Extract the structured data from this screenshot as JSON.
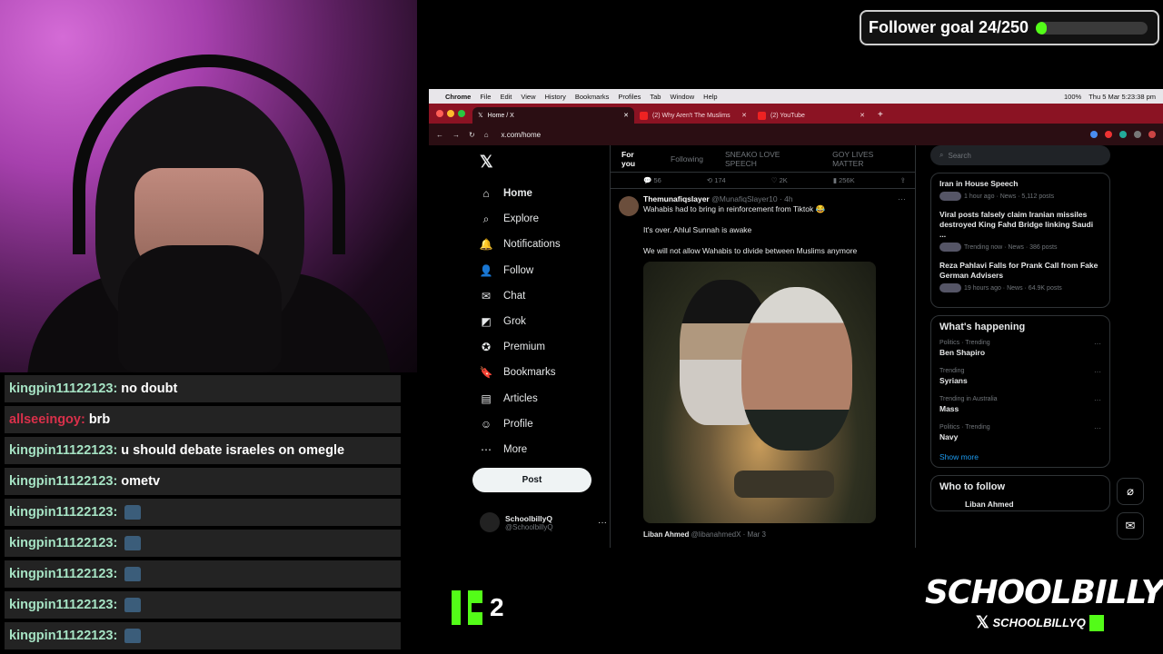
{
  "goal": {
    "label": "Follower goal 24/250",
    "progress": 0.096
  },
  "chat": [
    {
      "user": "kingpin11122123:",
      "text": "no doubt",
      "color": "#a6e3c4"
    },
    {
      "user": "allseeingoy:",
      "text": "brb",
      "color": "#d9304a"
    },
    {
      "user": "kingpin11122123:",
      "text": "u should debate israeles on omegle",
      "color": "#a6e3c4"
    },
    {
      "user": "kingpin11122123:",
      "text": "ometv",
      "color": "#a6e3c4"
    },
    {
      "user": "kingpin11122123:",
      "text": "",
      "color": "#a6e3c4"
    },
    {
      "user": "kingpin11122123:",
      "text": "",
      "color": "#a6e3c4"
    },
    {
      "user": "kingpin11122123:",
      "text": "",
      "color": "#a6e3c4"
    },
    {
      "user": "kingpin11122123:",
      "text": "",
      "color": "#a6e3c4"
    },
    {
      "user": "kingpin11122123:",
      "text": "",
      "color": "#a6e3c4"
    }
  ],
  "kick": {
    "count": "2"
  },
  "brand": {
    "name": "SCHOOLBILLYQ",
    "handle": "SCHOOLBILLYQ"
  },
  "mac": {
    "menus": [
      "Chrome",
      "File",
      "Edit",
      "View",
      "History",
      "Bookmarks",
      "Profiles",
      "Tab",
      "Window",
      "Help"
    ],
    "battery": "100%",
    "clock": "Thu 5 Mar  5:23:38 pm"
  },
  "browser": {
    "tabs": [
      {
        "title": "Home / X"
      },
      {
        "title": "(2) Why Aren't The Muslims"
      },
      {
        "title": "(2) YouTube"
      }
    ],
    "url": "x.com/home"
  },
  "x": {
    "nav": [
      "Home",
      "Explore",
      "Notifications",
      "Follow",
      "Chat",
      "Grok",
      "Premium",
      "Bookmarks",
      "Articles",
      "Profile",
      "More"
    ],
    "nav_icons": [
      "home-icon",
      "search-icon",
      "bell-icon",
      "follow-icon",
      "mail-icon",
      "grok-icon",
      "premium-icon",
      "bookmark-icon",
      "articles-icon",
      "profile-icon",
      "more-icon"
    ],
    "post_label": "Post",
    "me": {
      "name": "SchoolbillyQ",
      "handle": "@SchoolbillyQ"
    },
    "tabs": [
      "For you",
      "Following",
      "SNEAKO LOVE SPEECH",
      "GOY LIVES MATTER"
    ],
    "stats": [
      "56",
      "174",
      "2K",
      "256K"
    ],
    "tweet": {
      "name": "Themunafiqslayer",
      "meta": "@MunafiqSlayer10 · 4h",
      "line1": "Wahabis had to bring in reinforcement from Tiktok 😂",
      "line2": "It's over. Ahlul Sunnah is awake",
      "line3": "We will not allow Wahabis to divide between Muslims anymore"
    },
    "quote": {
      "name": "Liban Ahmed",
      "meta": "@libanahmedX · Mar 3"
    },
    "search_placeholder": "Search",
    "news": [
      {
        "title": "Iran in House Speech",
        "meta": "1 hour ago · News · 5,112 posts"
      },
      {
        "title": "Viral posts falsely claim Iranian missiles destroyed King Fahd Bridge linking Saudi ...",
        "meta": "Trending now · News · 386 posts"
      },
      {
        "title": "Reza Pahlavi Falls for Prank Call from Fake German Advisers",
        "meta": "19 hours ago · News · 64.9K posts"
      }
    ],
    "happening_title": "What's happening",
    "trends": [
      {
        "cat": "Politics · Trending",
        "name": "Ben Shapiro"
      },
      {
        "cat": "Trending",
        "name": "Syrians"
      },
      {
        "cat": "Trending in Australia",
        "name": "Mass"
      },
      {
        "cat": "Politics · Trending",
        "name": "Navy"
      }
    ],
    "show_more": "Show more",
    "who_title": "Who to follow",
    "who_first": "Liban Ahmed"
  }
}
